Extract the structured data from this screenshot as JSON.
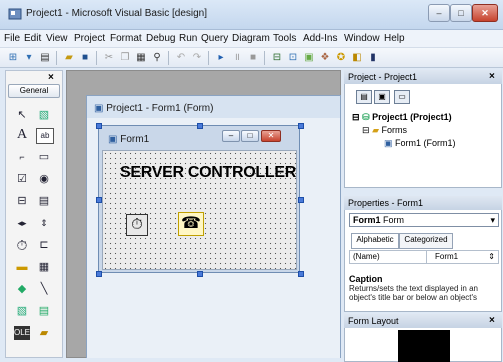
{
  "window": {
    "title": "Project1 - Microsoft Visual Basic [design]",
    "controls": {
      "minimize": "–",
      "maximize": "□",
      "close": "✕"
    }
  },
  "menu": [
    "File",
    "Edit",
    "View",
    "Project",
    "Format",
    "Debug",
    "Run",
    "Query",
    "Diagram",
    "Tools",
    "Add-Ins",
    "Window",
    "Help"
  ],
  "toolbox": {
    "close": "×",
    "tab": "General",
    "tools": [
      "pointer",
      "picturebox",
      "label",
      "textbox",
      "frame",
      "commandbutton",
      "checkbox",
      "optionbutton",
      "combobox",
      "listbox",
      "hscrollbar",
      "vscrollbar",
      "timer",
      "drivelistbox",
      "dirlistbox",
      "filelistbox",
      "shape",
      "line",
      "image",
      "data",
      "ole"
    ]
  },
  "designer": {
    "title": "Project1 - Form1 (Form)",
    "form": {
      "title": "Form1",
      "label_text": "SERVER CONTROLLER"
    }
  },
  "project_explorer": {
    "title": "Project - Project1",
    "close": "×",
    "tree": {
      "root": "Project1 (Project1)",
      "folder": "Forms",
      "item": "Form1 (Form1)"
    }
  },
  "properties": {
    "title": "Properties - Form1",
    "object_name": "Form1",
    "object_type": "Form",
    "tabs": [
      "Alphabetic",
      "Categorized"
    ],
    "row": {
      "name": "(Name)",
      "value": "Form1"
    },
    "desc_title": "Caption",
    "desc_text": "Returns/sets the text displayed in an object's title bar or below an object's"
  },
  "form_layout": {
    "title": "Form Layout",
    "close": "×"
  },
  "colors": {
    "mdi_background": "#a7a7a7",
    "title_gradient_top": "#dbe8f7",
    "close_red": "#c7432e"
  }
}
